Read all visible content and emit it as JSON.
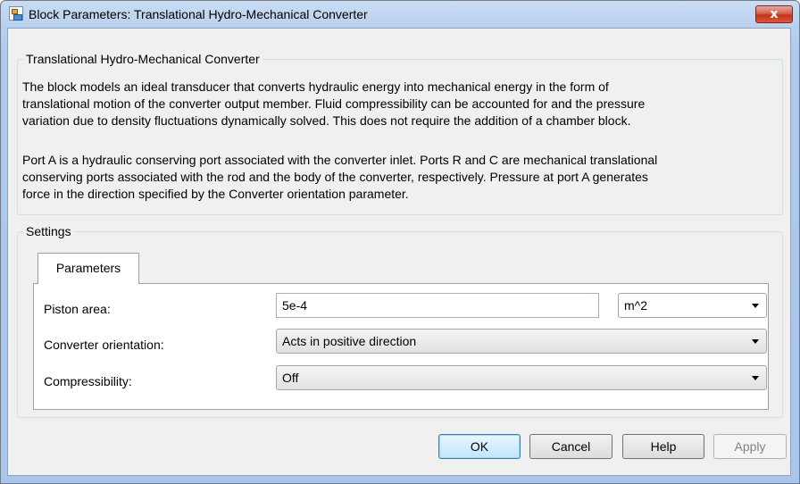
{
  "window": {
    "title": "Block Parameters: Translational Hydro-Mechanical Converter",
    "close_glyph": "x"
  },
  "description": {
    "group_label": "Translational Hydro-Mechanical Converter",
    "paragraph1_lines": [
      "The block models an ideal transducer that converts hydraulic energy into mechanical energy in the form of",
      "translational motion of the converter output member. Fluid compressibility can be accounted for and the pressure",
      "variation due to density fluctuations dynamically solved. This does not require the addition of a chamber block."
    ],
    "paragraph2_lines": [
      "Port A is a hydraulic conserving port associated with the converter inlet. Ports R and C are mechanical translational",
      "conserving ports associated with the rod and the body of the converter, respectively. Pressure at port A generates",
      "force in the direction specified by the Converter orientation parameter."
    ]
  },
  "settings": {
    "group_label": "Settings",
    "tab_label": "Parameters",
    "piston_area": {
      "label": "Piston area:",
      "value": "5e-4",
      "unit": "m^2"
    },
    "converter_orientation": {
      "label": "Converter orientation:",
      "value": "Acts in positive direction"
    },
    "compressibility": {
      "label": "Compressibility:",
      "value": "Off"
    }
  },
  "buttons": {
    "ok": "OK",
    "cancel": "Cancel",
    "help": "Help",
    "apply": "Apply"
  }
}
